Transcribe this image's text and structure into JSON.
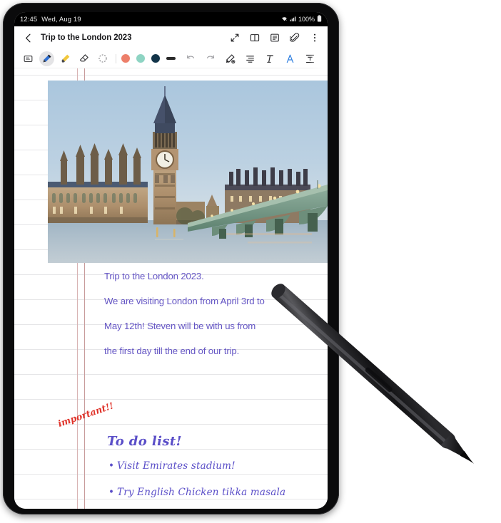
{
  "status_bar": {
    "time": "12:45",
    "date": "Wed, Aug 19",
    "battery_percent": "100%",
    "icons": [
      "wifi-icon",
      "signal-icon",
      "battery-icon"
    ]
  },
  "header": {
    "back_icon": "chevron-left-icon",
    "title": "Trip to the London 2023",
    "actions": [
      {
        "name": "expand-icon",
        "glyph": "expand"
      },
      {
        "name": "book-view-icon",
        "glyph": "book"
      },
      {
        "name": "outline-icon",
        "glyph": "list"
      },
      {
        "name": "attachment-icon",
        "glyph": "paperclip"
      },
      {
        "name": "more-options-icon",
        "glyph": "kebab"
      }
    ]
  },
  "toolbar": {
    "tools": [
      {
        "name": "note-card-tool",
        "label": "Note card",
        "selected": false
      },
      {
        "name": "pen-tool",
        "label": "Pen",
        "selected": true
      },
      {
        "name": "highlighter-tool",
        "label": "Highlighter",
        "selected": false
      },
      {
        "name": "eraser-tool",
        "label": "Eraser",
        "selected": false
      },
      {
        "name": "lasso-select-tool",
        "label": "Selection",
        "selected": false
      }
    ],
    "colors": [
      {
        "name": "color-swatch-coral",
        "hex": "#ED7F6A"
      },
      {
        "name": "color-swatch-mint",
        "hex": "#8ED4C3"
      },
      {
        "name": "color-swatch-navy",
        "hex": "#123449"
      }
    ],
    "thickness": {
      "name": "stroke-thickness",
      "hex": "#2a2a2a"
    },
    "actions": [
      {
        "name": "undo-button",
        "label": "Undo"
      },
      {
        "name": "redo-button",
        "label": "Redo"
      },
      {
        "name": "convert-handwriting-button",
        "label": "Convert handwriting"
      },
      {
        "name": "text-align-button",
        "label": "Align"
      },
      {
        "name": "text-style-button",
        "label": "Text style"
      },
      {
        "name": "ai-assist-button",
        "label": "AI assist",
        "active": true,
        "hex": "#2f7fe0"
      },
      {
        "name": "text-box-button",
        "label": "Text box"
      },
      {
        "name": "overflow-tool",
        "label": "More tools"
      }
    ]
  },
  "note": {
    "photo": {
      "name": "big-ben-photo",
      "alt": "Big Ben and the Palace of Westminster with Westminster Bridge over the River Thames at dusk"
    },
    "typed_lines": [
      "Trip to the London 2023.",
      "We are visiting London from April 3rd to",
      "May 12th! Steven will be with us from",
      "the first day till the end of our trip."
    ],
    "annotation": "important!!",
    "handwritten_heading": "To do list!",
    "handwritten_items": [
      "Visit Emirates stadium!",
      "Try English Chicken tikka masala"
    ],
    "text_color": "#6455c4",
    "annotation_color": "#e0332a"
  },
  "device": {
    "stylus": {
      "name": "s-pen-stylus",
      "label": "S Pen"
    }
  }
}
